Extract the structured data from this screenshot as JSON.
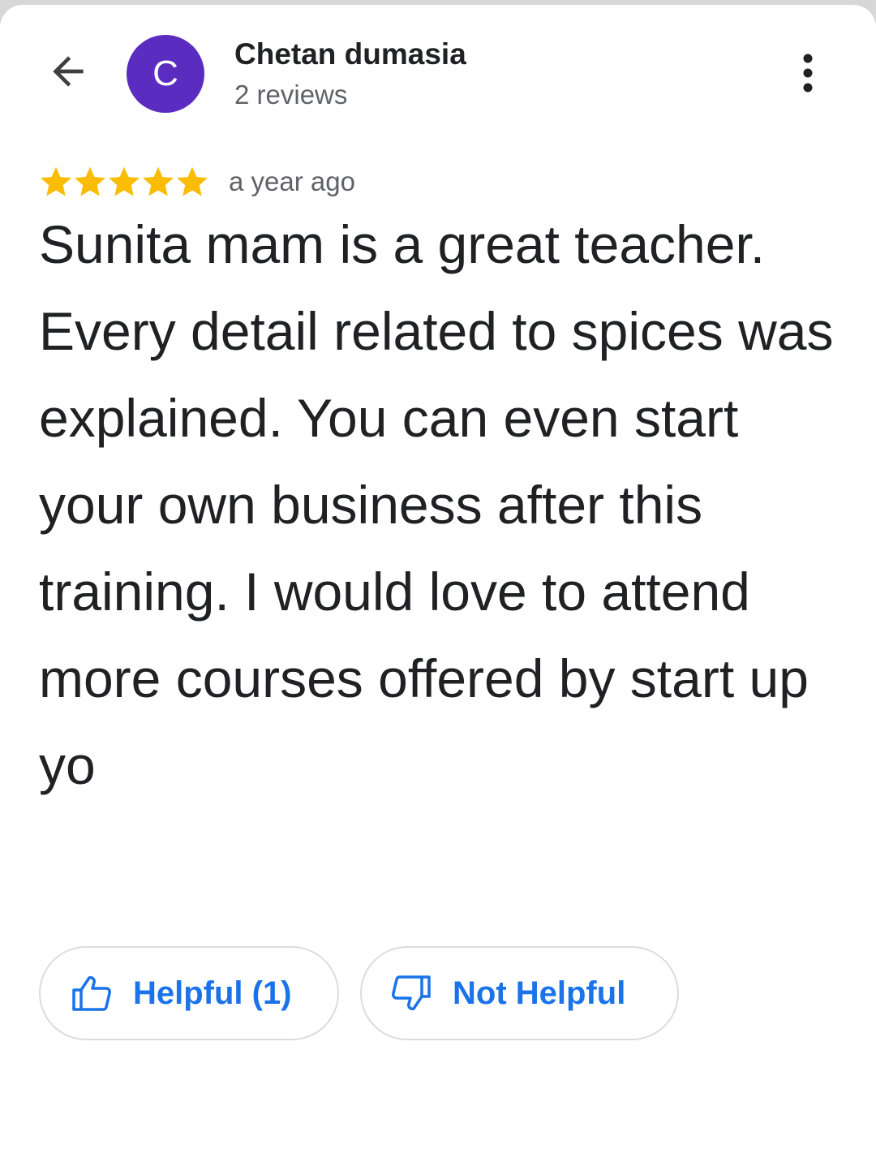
{
  "colors": {
    "avatar": "#5b2cc0",
    "star": "#fbbc04",
    "accent": "#1a73e8",
    "primary_text": "#202124",
    "secondary_text": "#5f6368",
    "border": "#dadce0"
  },
  "header": {
    "back_icon": "arrow-back-icon",
    "avatar_letter": "C",
    "reviewer_name": "Chetan dumasia",
    "review_count": "2 reviews",
    "more_icon": "more-vertical-icon"
  },
  "review": {
    "rating": 5,
    "rating_max": 5,
    "time": "a year ago",
    "text": "Sunita mam is a great teacher. Every detail related to spices was explained. You can even start your own business after this training. I would love to attend more courses offered by start up yo"
  },
  "actions": {
    "helpful_label": "Helpful (1)",
    "helpful_icon": "thumbs-up-icon",
    "not_helpful_label": "Not Helpful",
    "not_helpful_icon": "thumbs-down-icon"
  }
}
